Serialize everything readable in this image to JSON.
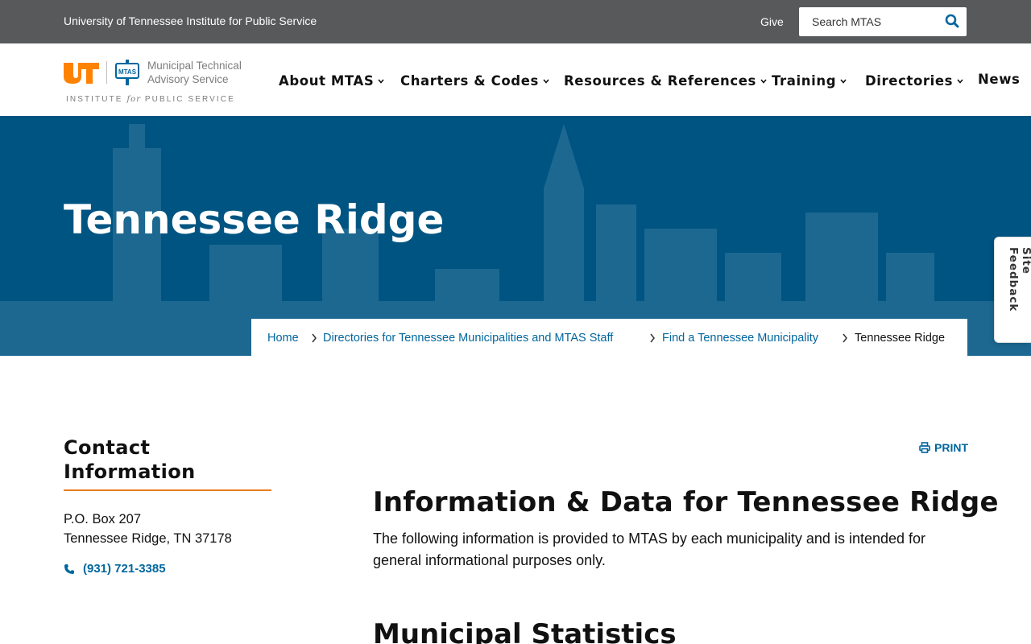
{
  "utility_bar": {
    "org_name": "University of Tennessee Institute for Public Service",
    "give_label": "Give",
    "search_placeholder": "Search MTAS"
  },
  "logo": {
    "ut_mark": "UT",
    "mtas_badge": "MTAS",
    "line1": "Municipal Technical",
    "line2": "Advisory Service",
    "sub_pre": "INSTITUTE",
    "sub_for": "for",
    "sub_post": "PUBLIC SERVICE"
  },
  "nav": {
    "items": [
      {
        "label": "About MTAS",
        "has_menu": true
      },
      {
        "label": "Charters & Codes",
        "has_menu": true
      },
      {
        "label": "Resources & References",
        "has_menu": true
      },
      {
        "label": "Training",
        "has_menu": true
      },
      {
        "label": "Directories",
        "has_menu": true
      },
      {
        "label": "News",
        "has_menu": false
      }
    ]
  },
  "hero": {
    "title": "Tennessee Ridge"
  },
  "breadcrumb": {
    "items": [
      {
        "label": "Home",
        "link": true
      },
      {
        "label": "Directories for Tennessee Municipalities and MTAS Staff",
        "link": true
      },
      {
        "label": "Find a Tennessee Municipality",
        "link": true
      },
      {
        "label": "Tennessee Ridge",
        "link": false
      }
    ]
  },
  "site_feedback": {
    "label": "Site Feedback"
  },
  "contact": {
    "heading": "Contact Information",
    "address_line1": "P.O. Box 207",
    "address_line2": "Tennessee Ridge, TN 37178",
    "phone": "(931) 721-3385"
  },
  "main": {
    "print_label": "PRINT",
    "heading": "Information & Data for Tennessee Ridge",
    "intro": "The following information is provided to MTAS by each municipality and is intended for general informational purposes only.",
    "section_heading": "Municipal Statistics"
  },
  "colors": {
    "utility_bar": "#58595b",
    "hero_blue": "#005481",
    "link_blue": "#00669e",
    "accent_orange": "#e87f1e",
    "ut_orange": "#ff8200"
  }
}
